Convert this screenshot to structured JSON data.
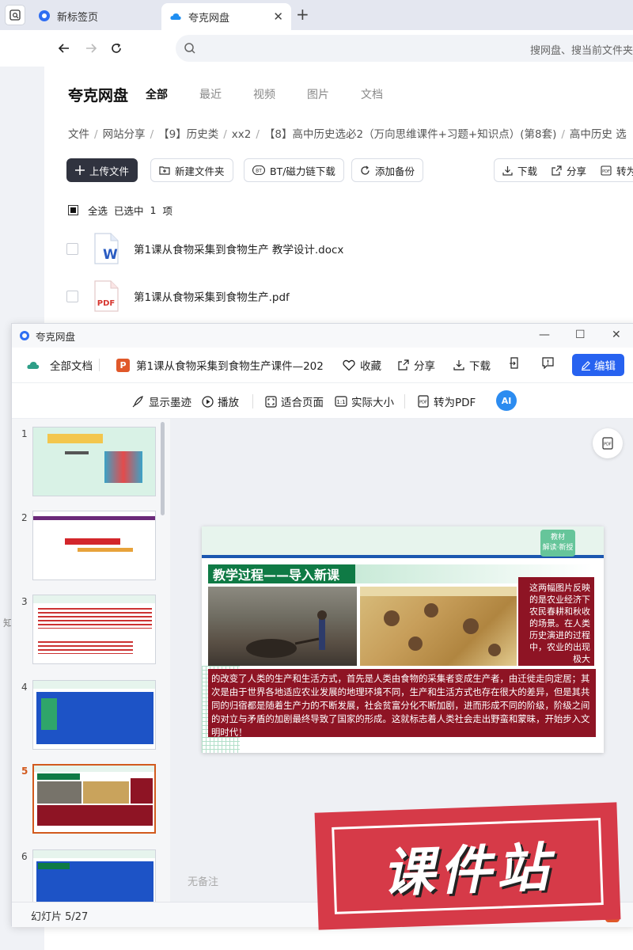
{
  "browser": {
    "tabs": [
      {
        "label": "新标签页"
      },
      {
        "label": "夸克网盘"
      }
    ],
    "address_placeholder": "搜网盘、搜当前文件夹"
  },
  "page": {
    "brand": "夸克网盘",
    "category_tabs": [
      "全部",
      "最近",
      "视频",
      "图片",
      "文档"
    ],
    "breadcrumb": [
      "文件",
      "网站分享",
      "【9】历史类",
      "xx2",
      "【8】高中历史选必2（万向思维课件+习题+知识点）(第8套)",
      "高中历史 选"
    ],
    "actions": {
      "upload": "上传文件",
      "new_folder": "新建文件夹",
      "bt": "BT/磁力链下载",
      "backup": "添加备份",
      "download": "下载",
      "share": "分享",
      "to_pdf": "转为"
    },
    "selection": {
      "select_all": "全选",
      "selected_text": "已选中",
      "count": "1",
      "unit": "项"
    },
    "files": [
      {
        "name": "第1课从食物采集到食物生产 教学设计.docx",
        "type": "docx",
        "icon_text": "W"
      },
      {
        "name": "第1课从食物采集到食物生产.pdf",
        "type": "pdf",
        "icon_text": "PDF"
      }
    ],
    "side_fragment": "知"
  },
  "preview": {
    "window_title": "夸克网盘",
    "all_docs": "全部文档",
    "file_title": "第1课从食物采集到食物生产课件—202",
    "actions": {
      "favorite": "收藏",
      "share": "分享",
      "download": "下载",
      "edit": "编辑"
    },
    "toolbar": {
      "ink": "显示墨迹",
      "play": "播放",
      "fit": "适合页面",
      "actual": "实际大小",
      "to_pdf": "转为PDF",
      "ai": "AI"
    },
    "thumbnails": [
      "1",
      "2",
      "3",
      "4",
      "5",
      "6"
    ],
    "active_thumbnail": 5,
    "notes": "无备注",
    "slide_count": "幻灯片 5/27",
    "slide": {
      "tag_line1": "教材",
      "tag_line2": "解读·新授",
      "title": "教学过程——导入新课",
      "side_text": "这两幅图片反映的是农业经济下农民春耕和秋收的场景。在人类历史演进的过程中，农业的出现极大",
      "bottom_text": "的改变了人类的生产和生活方式，首先是人类由食物的采集者变成生产者，由迁徙走向定居；其次是由于世界各地适应农业发展的地理环境不同，生产和生活方式也存在很大的差异，但是其共同的归宿都是随着生产力的不断发展，社会贫富分化不断加剧，进而形成不同的阶级，阶级之间的对立与矛盾的加剧最终导致了国家的形成。这就标志着人类社会走出野蛮和蒙昧，开始步入文明时代！"
    }
  },
  "watermark": "课件站",
  "colors": {
    "accent": "#2762f0",
    "dark_button": "#30333f",
    "slide_red": "#8e1424",
    "slide_green": "#0f7a45"
  }
}
